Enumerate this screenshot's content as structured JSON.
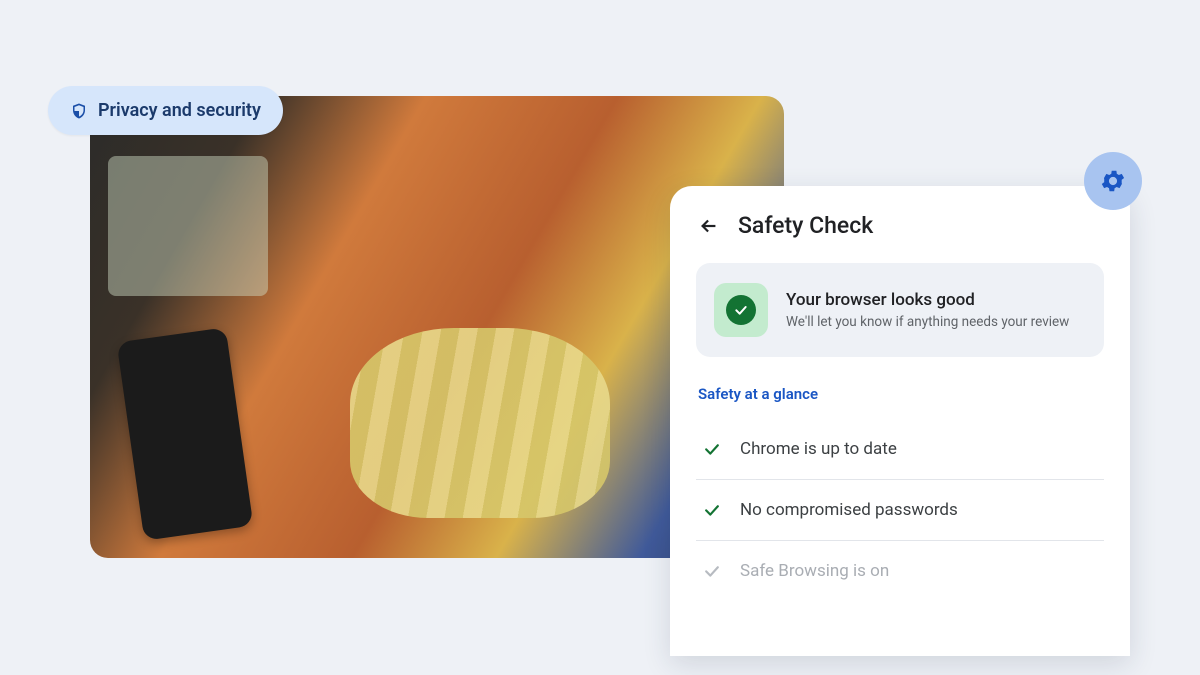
{
  "chip": {
    "label": "Privacy and security"
  },
  "card": {
    "title": "Safety Check",
    "status_title": "Your browser looks good",
    "status_sub": "We'll let you know if anything needs your review",
    "section_label": "Safety at a glance",
    "items": [
      {
        "label": "Chrome is up to date"
      },
      {
        "label": "No compromised passwords"
      },
      {
        "label": "Safe Browsing is on"
      }
    ]
  }
}
